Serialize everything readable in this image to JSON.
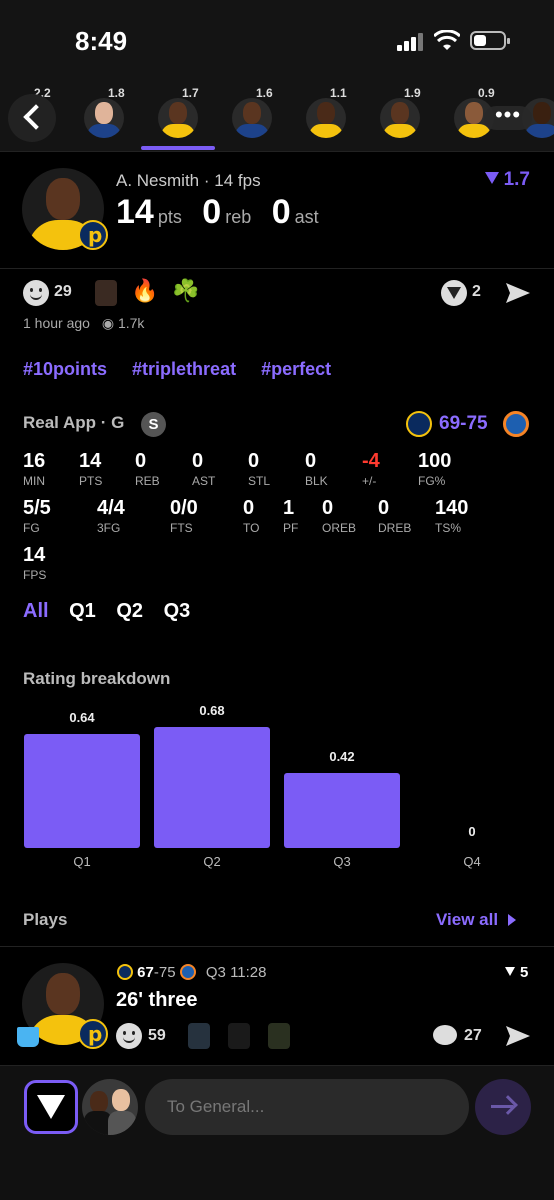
{
  "status_bar": {
    "time": "8:49"
  },
  "players": [
    {
      "rating": "2.2"
    },
    {
      "rating": "1.8"
    },
    {
      "rating": "1.7"
    },
    {
      "rating": "1.6"
    },
    {
      "rating": "1.1"
    },
    {
      "rating": "1.9"
    },
    {
      "rating": "0.9"
    },
    {
      "rating": ""
    }
  ],
  "header": {
    "name": "A. Nesmith",
    "fps_text": "· 14 fps",
    "pts": "14",
    "pts_label": "pts",
    "reb": "0",
    "reb_label": "reb",
    "ast": "0",
    "ast_label": "ast",
    "score": "1.7"
  },
  "reactions": {
    "smile_count": "29",
    "fire": "🔥",
    "shamrock": "☘️",
    "badge_count": "2",
    "time": "1 hour ago",
    "views": "1.7k"
  },
  "hashtags": [
    "#10points",
    "#triplethreat",
    "#perfect"
  ],
  "game": {
    "label": "Real App · G",
    "badge": "S",
    "score": "69-75",
    "colors": {
      "pacers_navy": "#0a2a5e",
      "pacers_gold": "#f4c20d",
      "knicks_blue": "#1d5fb0",
      "knicks_orange": "#f58426"
    },
    "stats_row1": [
      {
        "v": "16",
        "k": "MIN"
      },
      {
        "v": "14",
        "k": "PTS"
      },
      {
        "v": "0",
        "k": "REB"
      },
      {
        "v": "0",
        "k": "AST"
      },
      {
        "v": "0",
        "k": "STL"
      },
      {
        "v": "0",
        "k": "BLK"
      },
      {
        "v": "-4",
        "k": "+/-"
      },
      {
        "v": "100",
        "k": "FG%"
      }
    ],
    "stats_row2": [
      {
        "v": "5/5",
        "k": "FG"
      },
      {
        "v": "4/4",
        "k": "3FG"
      },
      {
        "v": "0/0",
        "k": "FTS"
      },
      {
        "v": "0",
        "k": "TO"
      },
      {
        "v": "1",
        "k": "PF"
      },
      {
        "v": "0",
        "k": "OREB"
      },
      {
        "v": "0",
        "k": "DREB"
      },
      {
        "v": "140",
        "k": "TS%"
      }
    ],
    "stats_row3": [
      {
        "v": "14",
        "k": "FPS"
      }
    ]
  },
  "periods": [
    "All",
    "Q1",
    "Q2",
    "Q3"
  ],
  "rating_breakdown": {
    "title": "Rating breakdown"
  },
  "chart_data": {
    "type": "bar",
    "categories": [
      "Q1",
      "Q2",
      "Q3",
      "Q4"
    ],
    "values": [
      0.64,
      0.68,
      0.42,
      0
    ],
    "value_labels": [
      "0.64",
      "0.68",
      "0.42",
      "0"
    ],
    "color": "#7b5cf5"
  },
  "plays": {
    "title": "Plays",
    "view_all": "View all",
    "item": {
      "score_home": "67",
      "score_away": "-75",
      "clock": "Q3 11:28",
      "points": "5",
      "title": "26' three",
      "smile_count": "59",
      "comment_count": "27"
    }
  },
  "composer": {
    "placeholder": "To General..."
  },
  "accent": "#7b5cf5"
}
